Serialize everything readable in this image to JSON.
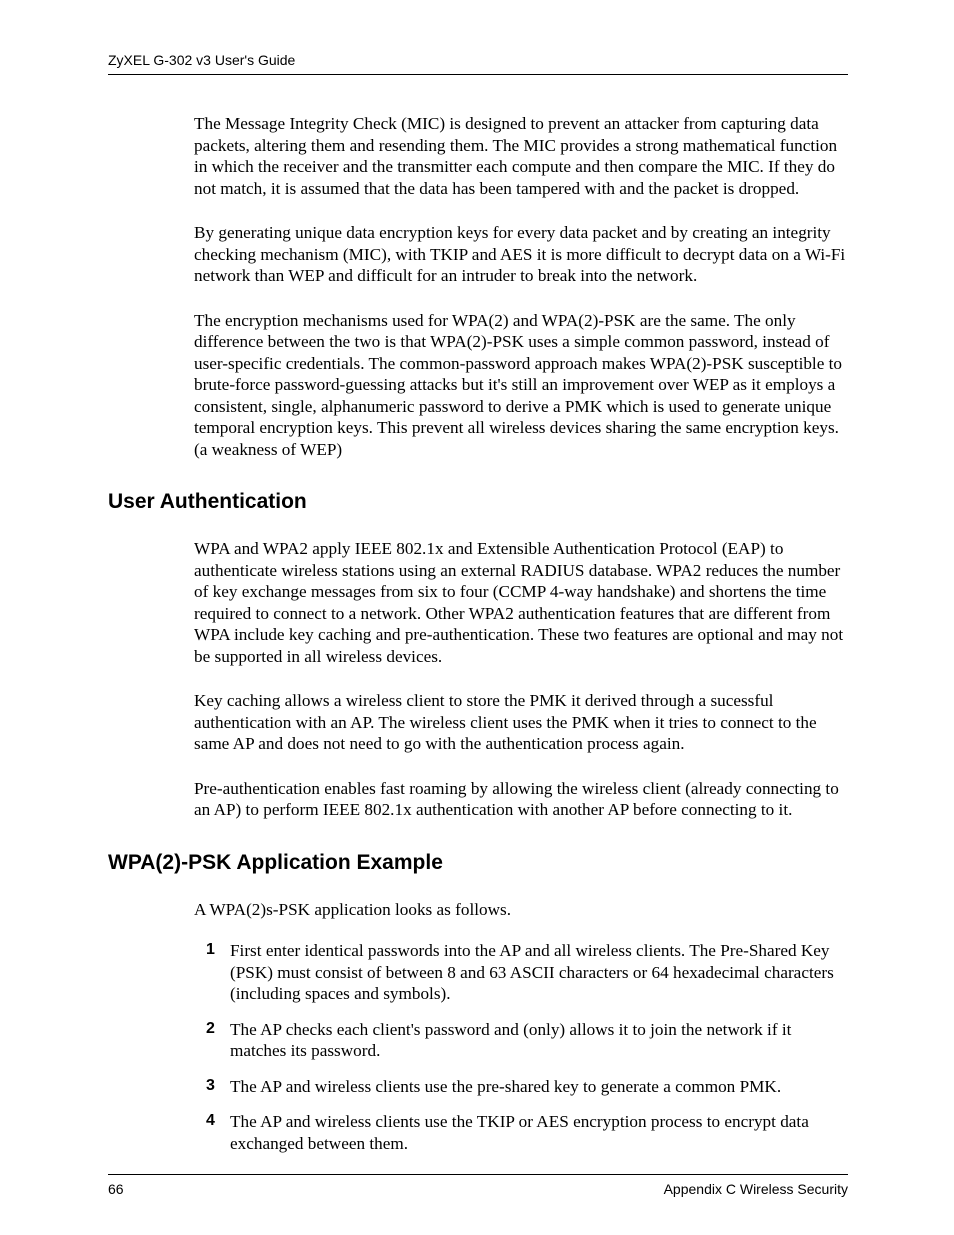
{
  "header": {
    "running_head": "ZyXEL G-302 v3 User's Guide"
  },
  "intro": {
    "p1": "The Message Integrity Check (MIC) is designed to prevent an attacker from capturing data packets, altering them and resending them. The MIC provides a strong mathematical function in which the receiver and the transmitter each compute and then compare the MIC. If they do not match, it is assumed that the data has been tampered with and the packet is dropped.",
    "p2": "By generating unique data encryption keys for every data packet and by creating an integrity checking mechanism (MIC), with TKIP and AES it is more difficult to decrypt data on a Wi-Fi network than WEP and difficult for an intruder to break into the network.",
    "p3": "The encryption mechanisms used for WPA(2) and WPA(2)-PSK are the same. The only difference between the two is that WPA(2)-PSK uses a simple common password, instead of user-specific credentials. The common-password approach makes WPA(2)-PSK susceptible to brute-force password-guessing attacks but it's still an improvement over WEP as it employs a consistent, single, alphanumeric password to derive a PMK which is used to generate unique temporal encryption keys. This prevent all wireless devices sharing the same encryption keys. (a weakness of WEP)"
  },
  "sections": {
    "user_auth": {
      "heading": "User Authentication",
      "p1": "WPA and WPA2 apply IEEE 802.1x and Extensible Authentication Protocol (EAP) to authenticate wireless stations using an external RADIUS database. WPA2 reduces the number of key exchange messages from six to four (CCMP 4-way handshake) and shortens the time required to connect to a network. Other WPA2 authentication features that are different from WPA include key caching and pre-authentication. These two features are optional and may not be supported in all wireless devices.",
      "p2": "Key caching allows a wireless client to store the PMK it derived through a sucessful authentication with an AP. The wireless client uses the PMK when it tries to connect to the same AP and does not need to go with the authentication process again.",
      "p3": "Pre-authentication enables fast roaming by allowing the wireless client (already connecting to an AP) to perform IEEE 802.1x authentication with another AP before connecting to it."
    },
    "wpa_psk": {
      "heading": "WPA(2)-PSK Application Example",
      "intro": "A WPA(2)s-PSK application looks as follows.",
      "steps": [
        "First enter identical passwords into the AP and all wireless clients. The Pre-Shared Key (PSK) must consist of between 8 and 63 ASCII characters or 64 hexadecimal characters (including spaces and symbols).",
        "The AP checks each client's password and (only) allows it to join the network if it matches its password.",
        "The AP and wireless clients use the pre-shared key to generate a common PMK.",
        "The AP and wireless clients use the TKIP or AES encryption process to encrypt data exchanged between them."
      ],
      "step_numbers": [
        "1",
        "2",
        "3",
        "4"
      ]
    }
  },
  "footer": {
    "page_number": "66",
    "section_label": "Appendix C Wireless Security"
  }
}
